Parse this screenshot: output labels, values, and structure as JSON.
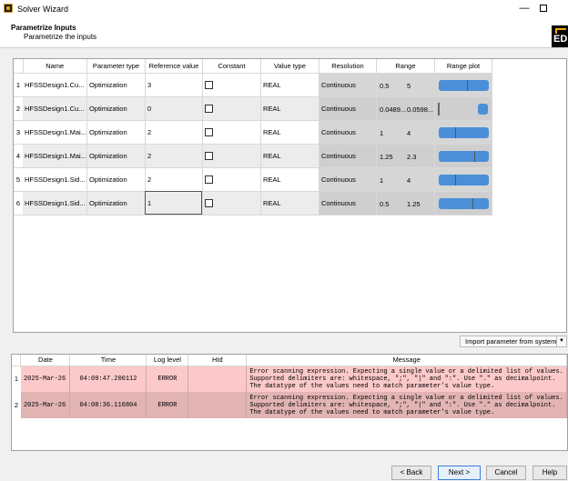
{
  "window": {
    "title": "Solver Wizard",
    "minimize": "—",
    "maximize": ""
  },
  "header": {
    "title": "Parametrize Inputs",
    "subtitle": "Parametrize the inputs",
    "logo_text": "ED"
  },
  "params": {
    "columns": [
      "Name",
      "Parameter type",
      "Reference value",
      "Constant",
      "Value type",
      "Resolution",
      "Range",
      "Range plot"
    ],
    "rows": [
      {
        "num": "1",
        "name": "HFSSDesign1.Cu...",
        "ptype": "Optimization",
        "ref": "3",
        "constant": false,
        "vtype": "REAL",
        "resolution": "Continuous",
        "range_min": "0.5",
        "range_max": "5",
        "plot_value_fraction": 0.56
      },
      {
        "num": "2",
        "name": "HFSSDesign1.Cu...",
        "ptype": "Optimization",
        "ref": "0",
        "constant": false,
        "vtype": "REAL",
        "resolution": "Continuous",
        "range_min": "0.0489...",
        "range_max": "0.0598...",
        "plot_value_fraction": 0.0
      },
      {
        "num": "3",
        "name": "HFSSDesign1.Mai...",
        "ptype": "Optimization",
        "ref": "2",
        "constant": false,
        "vtype": "REAL",
        "resolution": "Continuous",
        "range_min": "1",
        "range_max": "4",
        "plot_value_fraction": 0.33
      },
      {
        "num": "4",
        "name": "HFSSDesign1.Mai...",
        "ptype": "Optimization",
        "ref": "2",
        "constant": false,
        "vtype": "REAL",
        "resolution": "Continuous",
        "range_min": "1.25",
        "range_max": "2.3",
        "plot_value_fraction": 0.71
      },
      {
        "num": "5",
        "name": "HFSSDesign1.Sid...",
        "ptype": "Optimization",
        "ref": "2",
        "constant": false,
        "vtype": "REAL",
        "resolution": "Continuous",
        "range_min": "1",
        "range_max": "4",
        "plot_value_fraction": 0.33
      },
      {
        "num": "6",
        "name": "HFSSDesign1.Sid...",
        "ptype": "Optimization",
        "ref": "1",
        "constant": false,
        "vtype": "REAL",
        "resolution": "Continuous",
        "range_min": "0.5",
        "range_max": "1.25",
        "plot_value_fraction": 0.67
      }
    ]
  },
  "import_button": {
    "label": "Import parameter from system",
    "arrow": "▼"
  },
  "log": {
    "columns": [
      "Date",
      "Time",
      "Log level",
      "HId",
      "Message"
    ],
    "rows": [
      {
        "num": "1",
        "date": "2025-Mar-26",
        "time": "04:09:47.200112",
        "level": "ERROR",
        "hid": "",
        "message": "Error scanning expression. Expecting a single value or a delimited list of values. Supported delimiters are: whitespace, \";\", \"|\" and \":\". Use \".\" as decimalpoint. The datatype of the values need to match parameter's value type."
      },
      {
        "num": "2",
        "date": "2025-Mar-26",
        "time": "04:08:36.116804",
        "level": "ERROR",
        "hid": "",
        "message": "Error scanning expression. Expecting a single value or a delimited list of values. Supported delimiters are: whitespace, \";\", \"|\" and \":\". Use \".\" as decimalpoint. The datatype of the values need to match parameter's value type."
      }
    ]
  },
  "footer": {
    "back": "< Back",
    "next": "Next >",
    "cancel": "Cancel",
    "help": "Help"
  }
}
